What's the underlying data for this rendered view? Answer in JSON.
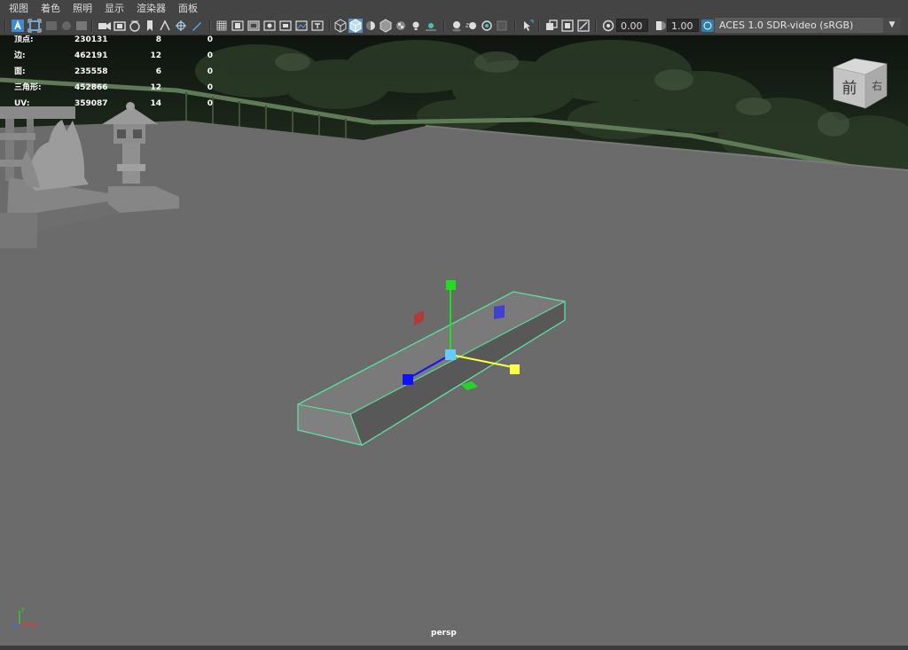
{
  "menu": [
    "视图",
    "着色",
    "照明",
    "显示",
    "渲染器",
    "面板"
  ],
  "toolbar": {
    "exposure_value": "0.00",
    "gamma_value": "1.00",
    "color_space": "ACES 1.0 SDR-video (sRGB)",
    "dropdown_arrow": "▼"
  },
  "hud": {
    "rows": [
      {
        "label": "顶点:",
        "v1": "230131",
        "v2": "8",
        "v3": "0"
      },
      {
        "label": "边:",
        "v1": "462191",
        "v2": "12",
        "v3": "0"
      },
      {
        "label": "面:",
        "v1": "235558",
        "v2": "6",
        "v3": "0"
      },
      {
        "label": "三角形:",
        "v1": "452866",
        "v2": "12",
        "v3": "0"
      },
      {
        "label": "UV:",
        "v1": "359087",
        "v2": "14",
        "v3": "0"
      }
    ]
  },
  "viewcube": {
    "front_label": "前",
    "right_label": "右"
  },
  "axis_gizmo": {
    "x_label": "x",
    "y_label": "y",
    "z_label": "z"
  },
  "camera_label": "persp",
  "colors": {
    "selection": "#5de0a0",
    "manip_x": "#ff3030",
    "manip_y": "#22dd22",
    "manip_z": "#1010ff",
    "manip_center": "#66ccff",
    "manip_yellow": "#ffff44"
  }
}
